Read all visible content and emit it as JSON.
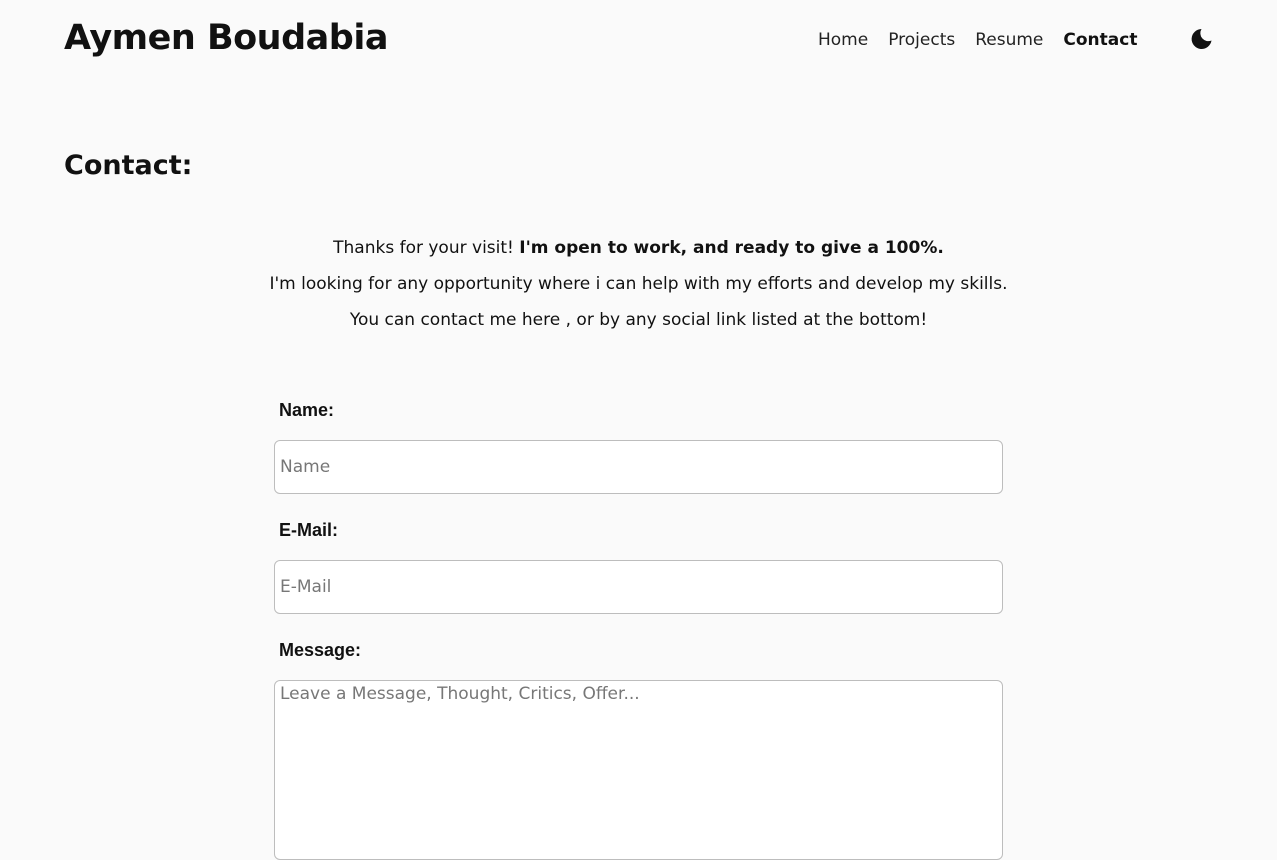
{
  "header": {
    "site_title": "Aymen Boudabia",
    "nav": {
      "home": "Home",
      "projects": "Projects",
      "resume": "Resume",
      "contact": "Contact"
    },
    "theme_toggle_icon": "moon-icon"
  },
  "page": {
    "heading": "Contact:",
    "intro": {
      "line1_normal": "Thanks for your visit! ",
      "line1_bold": "I'm open to work, and ready to give a 100%.",
      "line2": "I'm looking for any opportunity where i can help with my efforts and develop my skills.",
      "line3": "You can contact me here , or by any social link listed at the bottom!"
    }
  },
  "form": {
    "name_label": "Name:",
    "name_placeholder": "Name",
    "name_value": "",
    "email_label": "E-Mail:",
    "email_placeholder": "E-Mail",
    "email_value": "",
    "message_label": "Message:",
    "message_placeholder": "Leave a Message, Thought, Critics, Offer...",
    "message_value": ""
  }
}
